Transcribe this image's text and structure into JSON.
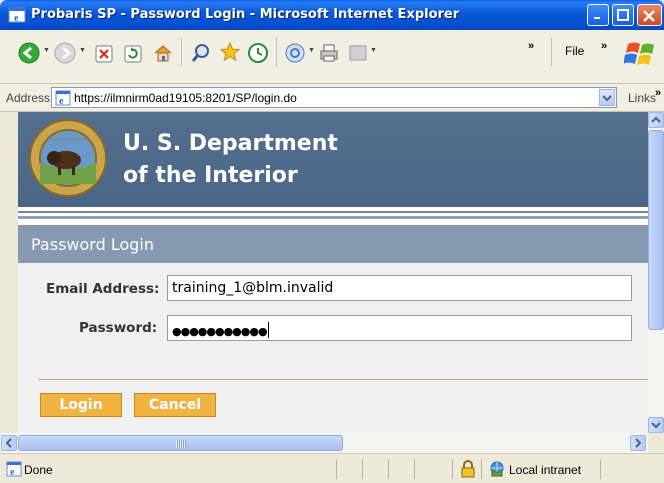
{
  "window": {
    "title": "Probaris SP - Password Login - Microsoft Internet Explorer"
  },
  "toolbar": {
    "menu_file": "File",
    "overflow_glyph": "»"
  },
  "addressbar": {
    "label": "Address",
    "url": "https://ilmnirm0ad19105:8201/SP/login.do",
    "links_label": "Links"
  },
  "banner": {
    "line1": "U. S. Department",
    "line2": "of the Interior"
  },
  "login": {
    "heading": "Password Login",
    "email_label": "Email Address:",
    "email_value": "training_1@blm.invalid",
    "password_label": "Password:",
    "password_value": "●●●●●●●●●●●",
    "login_button": "Login",
    "cancel_button": "Cancel"
  },
  "status": {
    "text": "Done",
    "zone": "Local intranet"
  },
  "colors": {
    "titlebar": "#0a5fe8",
    "banner": "#4f6a8a",
    "section_header": "#8699b1",
    "button": "#f1b443"
  }
}
